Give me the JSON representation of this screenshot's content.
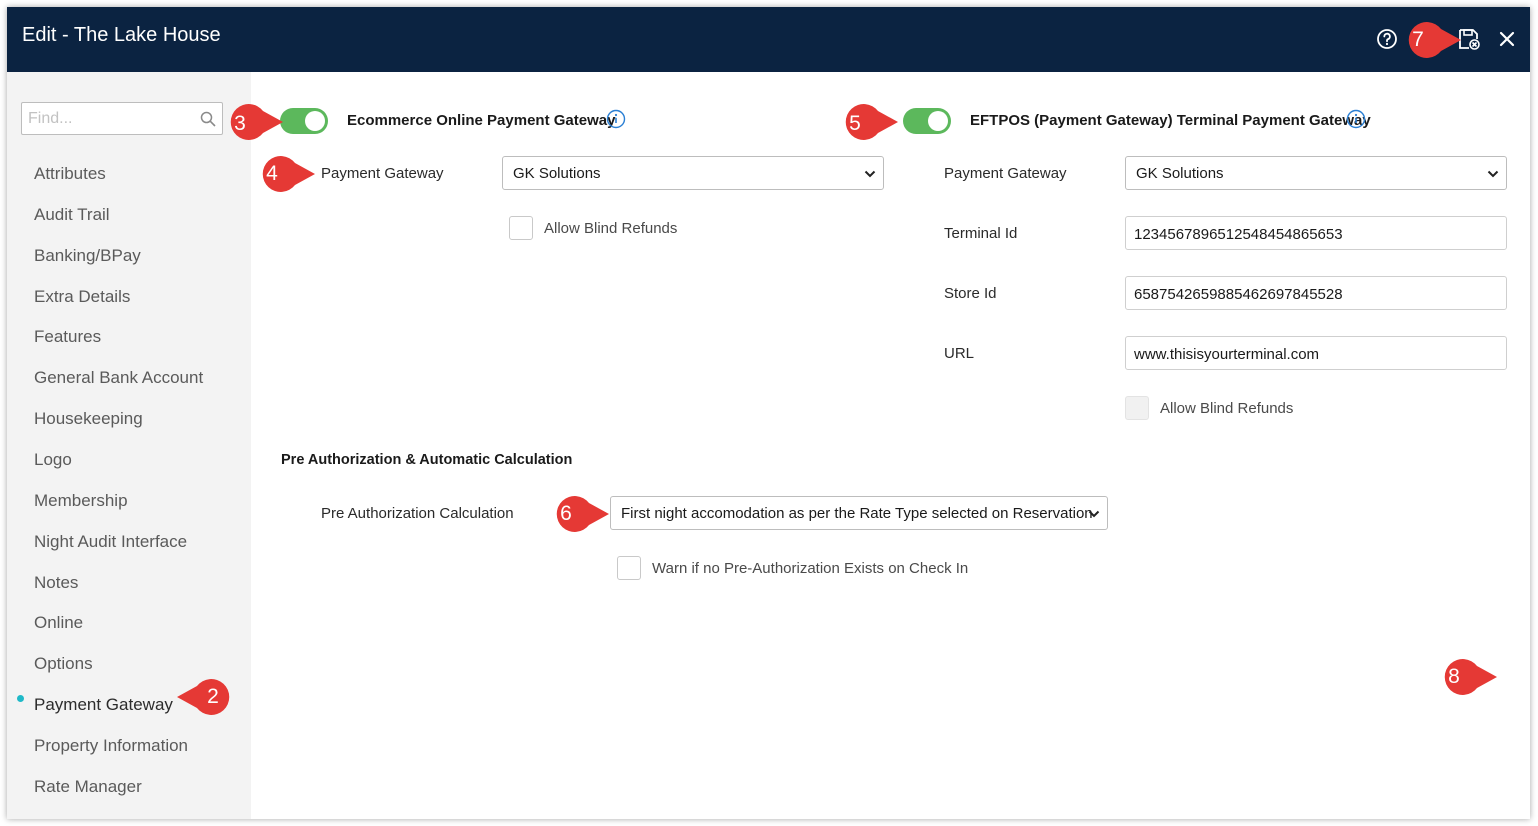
{
  "window": {
    "title": "Edit - The Lake House",
    "icons": [
      "help-icon",
      "save-close-icon",
      "close-icon"
    ]
  },
  "sidebar": {
    "search_placeholder": "Find...",
    "items": [
      {
        "label": "Attributes"
      },
      {
        "label": "Audit Trail"
      },
      {
        "label": "Banking/BPay"
      },
      {
        "label": "Extra Details"
      },
      {
        "label": "Features"
      },
      {
        "label": "General Bank Account"
      },
      {
        "label": "Housekeeping"
      },
      {
        "label": "Logo"
      },
      {
        "label": "Membership"
      },
      {
        "label": "Night Audit Interface"
      },
      {
        "label": "Notes"
      },
      {
        "label": "Online"
      },
      {
        "label": "Options"
      },
      {
        "label": "Payment Gateway"
      },
      {
        "label": "Property Information"
      },
      {
        "label": "Rate Manager"
      }
    ],
    "active_item": "Payment Gateway"
  },
  "ecommerce": {
    "heading": "Ecommerce Online Payment Gateway",
    "enabled": true,
    "gateway_label": "Payment Gateway",
    "gateway_value": "GK Solutions",
    "blind_refunds_label": "Allow Blind Refunds",
    "blind_refunds_checked": false
  },
  "eftpos": {
    "heading": "EFTPOS (Payment Gateway) Terminal Payment Gateway",
    "enabled": true,
    "gateway_label": "Payment Gateway",
    "gateway_value": "GK Solutions",
    "terminal_id_label": "Terminal Id",
    "terminal_id_value": "12345678965125484548656​53",
    "store_id_label": "Store Id",
    "store_id_value": "6587542659885462697845528",
    "url_label": "URL",
    "url_value": "www.thisisyourterminal.com",
    "blind_refunds_label": "Allow Blind Refunds",
    "blind_refunds_checked": false
  },
  "preauth": {
    "heading": "Pre Authorization & Automatic Calculation",
    "calc_label": "Pre Authorization Calculation",
    "calc_value": "First night accomodation as per the Rate Type selected on Reservation",
    "warn_label": "Warn if no Pre-Authorization Exists on Check In",
    "warn_checked": false
  },
  "callouts": [
    "2",
    "3",
    "4",
    "5",
    "6",
    "7",
    "8"
  ],
  "colors": {
    "titlebar": "#0b2341",
    "toggle_on": "#5cb85c",
    "active_dot": "#1fb9c8",
    "callout": "#e53935"
  }
}
